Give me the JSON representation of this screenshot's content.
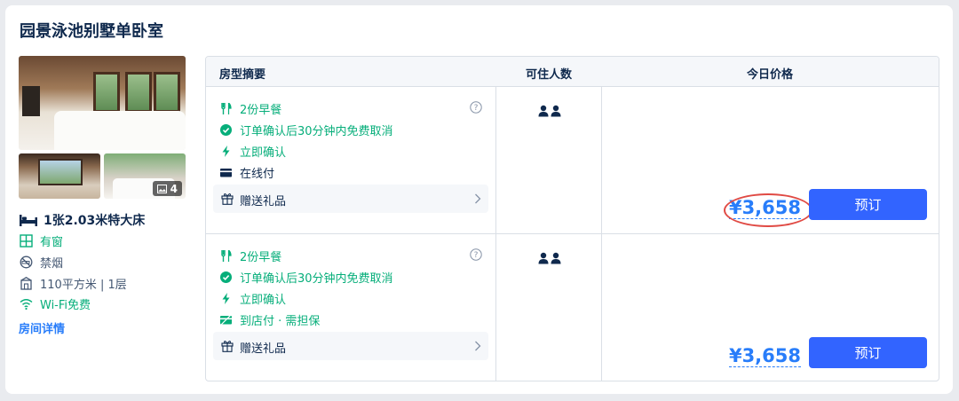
{
  "room": {
    "title": "园景泳池别墅单卧室",
    "photo_count": "4",
    "bed": "1张2.03米特大床",
    "window": "有窗",
    "smoking": "禁烟",
    "area": "110平方米 | 1层",
    "wifi": "Wi-Fi免费",
    "detail_link": "房间详情"
  },
  "table": {
    "headers": [
      "房型摘要",
      "可住人数",
      "今日价格"
    ],
    "offers": [
      {
        "breakfast": "2份早餐",
        "cancel": "订单确认后30分钟内免费取消",
        "confirm": "立即确认",
        "payment": "在线付",
        "gift": "赠送礼品",
        "price": "¥3,658",
        "book": "预订"
      },
      {
        "breakfast": "2份早餐",
        "cancel": "订单确认后30分钟内免费取消",
        "confirm": "立即确认",
        "payment": "到店付 · 需担保",
        "gift": "赠送礼品",
        "price": "¥3,658",
        "book": "预订"
      }
    ]
  },
  "colors": {
    "accent": "#287dfa",
    "button": "#3264ff",
    "green": "#06ae7a",
    "annotation": "#e04a44"
  }
}
